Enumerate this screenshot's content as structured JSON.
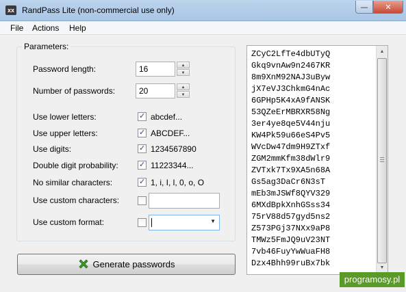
{
  "window": {
    "title": "RandPass Lite (non-commercial use only)",
    "icon_text": "xx",
    "minimize_glyph": "—",
    "close_glyph": "✕"
  },
  "menu": [
    "File",
    "Actions",
    "Help"
  ],
  "parameters": {
    "group_title": "Parameters:",
    "password_length_label": "Password length:",
    "password_length_value": "16",
    "number_of_passwords_label": "Number of passwords:",
    "number_of_passwords_value": "20",
    "options": [
      {
        "label": "Use lower letters:",
        "checked": true,
        "text": "abcdef..."
      },
      {
        "label": "Use upper letters:",
        "checked": true,
        "text": "ABCDEF..."
      },
      {
        "label": "Use digits:",
        "checked": true,
        "text": "1234567890"
      },
      {
        "label": "Double digit probability:",
        "checked": true,
        "text": "11223344..."
      },
      {
        "label": "No similar characters:",
        "checked": true,
        "text": "1, i, I, l, 0, o, O"
      }
    ],
    "custom_characters_label": "Use custom characters:",
    "custom_characters_checked": false,
    "custom_characters_value": "",
    "custom_format_label": "Use custom format:",
    "custom_format_checked": false,
    "custom_format_value": ""
  },
  "generate_button": {
    "label": "Generate passwords",
    "icon": "generate-icon"
  },
  "passwords": [
    "ZCyC2LfTe4dbUTyQ",
    "Gkq9vnAw9n2467KR",
    "8m9XnM92NAJ3uByw",
    "jX7eVJ3ChkmG4nAc",
    "6GPHp5K4xA9fANSK",
    "53QZeErMBRXR58Ng",
    "3er4ye8qe5V44nju",
    "KW4Pk59u66eS4Pv5",
    "WVcDw47dm9H9ZTxf",
    "ZGM2mmKfm38dWlr9",
    "ZVTxk7Tx9XA5n68A",
    "Gs5ag3DaCr6N3sT",
    "mEb3mJSWf8QYV329",
    "6MXdBpkXnhGSss34",
    "75rV88d57gyd5ns2",
    "Z573PGj37NXx9aP8",
    "TMWz5FmJQ9uV23NT",
    "7vb46FuyYwWuaFH8",
    "Dzx4Bhh99ruBx7bk"
  ],
  "watermark": "programosy.pl"
}
